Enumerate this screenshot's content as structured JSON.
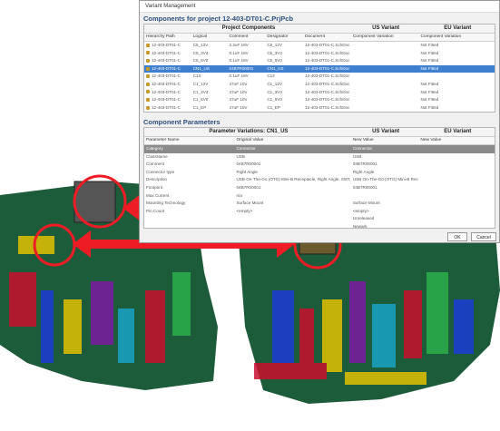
{
  "window_title": "Variant Management",
  "components_header": "Components for project 12-403-DT01-C.PrjPcb",
  "table": {
    "group_header": "Project Components",
    "us_variant": "US Variant",
    "eu_variant": "EU Variant",
    "columns": [
      "Hierarchy Path",
      "Logical",
      "Comment",
      "Designator",
      "Document",
      "Component Variation",
      "Component Variation"
    ],
    "rows": [
      [
        "12-403-DT01-C",
        "C5_12V",
        "2.2uF 16V",
        "C5_12V",
        "12-403-DT01-C.SchDoc",
        "",
        "Not Fitted"
      ],
      [
        "12-403-DT01-C",
        "C5_3V3",
        "0.1uF 16V",
        "C5_3V3",
        "12-403-DT01-C.SchDoc",
        "",
        "Not Fitted"
      ],
      [
        "12-403-DT01-C",
        "C5_5V0",
        "0.1uF 16V",
        "C5_5V0",
        "12-403-DT01-C.SchDoc",
        "",
        "Not Fitted"
      ],
      [
        "12-403-DT01-C",
        "CN1_US",
        "04B7R00001",
        "CN1_US",
        "12-403-DT01-C.SchDoc",
        "",
        "Not Fitted"
      ],
      [
        "12-403-DT01-C",
        "C13",
        "0.1uF 16V",
        "C13",
        "12-403-DT01-C.SchDoc",
        "",
        ""
      ],
      [
        "12-403-DT01-C",
        "C1_12V",
        "47uF 10V",
        "C1_12V",
        "12-403-DT01-C.SchDoc",
        "",
        "Not Fitted"
      ],
      [
        "12-403-DT01-C",
        "C1_3V3",
        "47uF 10V",
        "C1_3V3",
        "12-403-DT01-C.SchDoc",
        "",
        "Not Fitted"
      ],
      [
        "12-403-DT01-C",
        "C1_5V0",
        "47uF 10V",
        "C1_5V0",
        "12-403-DT01-C.SchDoc",
        "",
        "Not Fitted"
      ],
      [
        "12-403-DT01-C",
        "C1_EP",
        "47uF 10V",
        "C1_EP",
        "12-403-DT01-C.SchDoc",
        "",
        "Not Fitted"
      ],
      [
        "12-403-DT01-C",
        "C1_US",
        "47uF 10V",
        "C1_US",
        "12-403-DT01-C.SchDoc",
        "",
        "Not Fitted"
      ],
      [
        "12-403-DT01-C",
        "C2_12V",
        "0.1uF 16V",
        "C2_12V",
        "12-403-DT01-C.SchDoc",
        "",
        ""
      ],
      [
        "12-403-DT01-C",
        "C2_3V3",
        "0.1uF 16V",
        "C2_3V3",
        "12-403-DT01-C.SchDoc",
        "",
        ""
      ],
      [
        "12-403-DT01-C",
        "C2_5V0",
        "0.1uF 16V",
        "C2_5V0",
        "12-403-DT01-C.SchDoc",
        "",
        ""
      ]
    ],
    "selected_index": 3
  },
  "params_header": "Component Parameters",
  "params": {
    "group_header": "Parameter Variations: CN1_US",
    "us_variant": "US Variant",
    "eu_variant": "EU Variant",
    "columns": [
      "Parameter Name",
      "Original Value",
      "New Value",
      "New Value"
    ],
    "rows": [
      [
        "Category",
        "Connector",
        "Connector",
        ""
      ],
      [
        "ClassName",
        "USB",
        "USB",
        ""
      ],
      [
        "Comment",
        "04B7R00001",
        "04B7R00001",
        ""
      ],
      [
        "Connector type",
        "Right Angle",
        "Right Angle",
        ""
      ],
      [
        "Description",
        "USB On-The-Go (OTG) Mini-B Receptacle, Right Angle, SMT, 0.80mm (.031\") Pitch",
        "USB On-The-Go (OTG) Mini-B Receptacle",
        ""
      ],
      [
        "Footprint",
        "04B7R00001",
        "04B7R00001",
        ""
      ],
      [
        "Max Current",
        "n/a",
        "",
        ""
      ],
      [
        "Mounting Technology",
        "Surface Mount",
        "Surface Mount",
        ""
      ],
      [
        "Pin Count",
        "<empty>",
        "<empty>",
        ""
      ],
      [
        "",
        "",
        "Unreleased",
        ""
      ],
      [
        "",
        "",
        "Newark",
        ""
      ],
      [
        "Number 1",
        "B2R7406",
        "B2R7406",
        ""
      ]
    ]
  },
  "buttons": {
    "ok": "OK",
    "cancel": "Cancel"
  },
  "colors": {
    "selection": "#3f7fd0",
    "arrow": "#ee1c24",
    "pcb": "#1d5c3b"
  }
}
